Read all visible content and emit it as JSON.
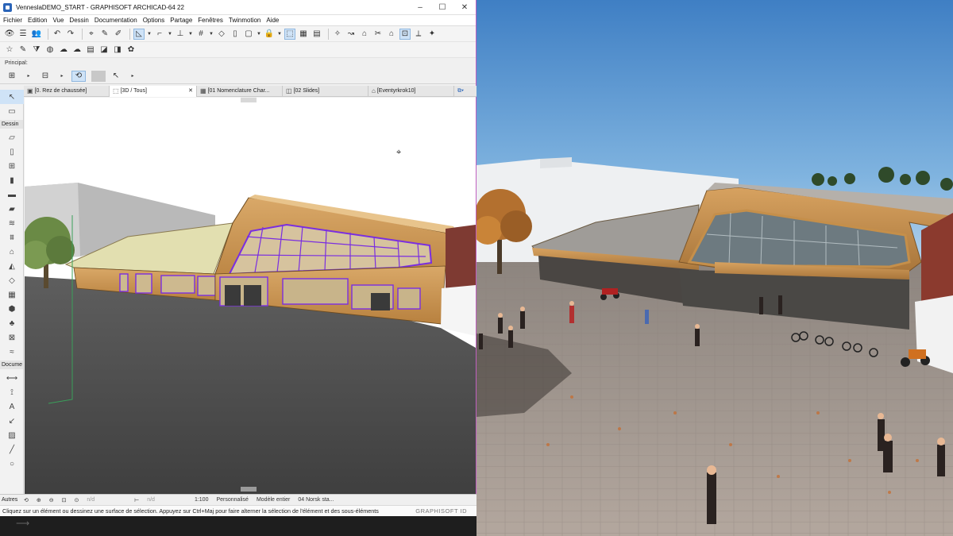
{
  "window": {
    "title": "VenneslaDEMO_START - GRAPHISOFT ARCHICAD-64 22",
    "minimize": "–",
    "maximize": "☐",
    "close": "✕"
  },
  "menu": [
    "Fichier",
    "Edition",
    "Vue",
    "Dessin",
    "Documentation",
    "Options",
    "Partage",
    "Fenêtres",
    "Twinmotion",
    "Aide"
  ],
  "toolbar_label": "Principal:",
  "tabs": [
    {
      "icon": "▣",
      "label": "[0. Rez de chaussée]",
      "close": "",
      "active": false
    },
    {
      "icon": "⬚",
      "label": "[3D / Tous]",
      "close": "✕",
      "active": true
    },
    {
      "icon": "▦",
      "label": "[01 Nomenclature Char...",
      "close": "",
      "active": false
    },
    {
      "icon": "◫",
      "label": "[02 Slides]",
      "close": "",
      "active": false
    },
    {
      "icon": "⌂",
      "label": "[Eventyrkrok10]",
      "close": "",
      "active": false
    }
  ],
  "toolbox": {
    "group_dessin": "Dessin",
    "group_document": "Docume",
    "group_autres": "Autres"
  },
  "statusbar": {
    "nd1": "n/d",
    "nd2": "n/d",
    "scale": "1:100",
    "override": "Personnalisé",
    "model": "Modèle entier",
    "view": "04 Norsk sta..."
  },
  "hint": "Cliquez sur un élément ou dessinez une surface de sélection. Appuyez sur Ctrl+Maj pour faire alterner la sélection de l'élément et des sous-éléments",
  "brand": "GRAPHISOFT ID",
  "colors": {
    "selection_outline": "#7a2ee0",
    "wood": "#c58f4a",
    "sky": "#6fa6d6",
    "paving": "#a69a92"
  }
}
